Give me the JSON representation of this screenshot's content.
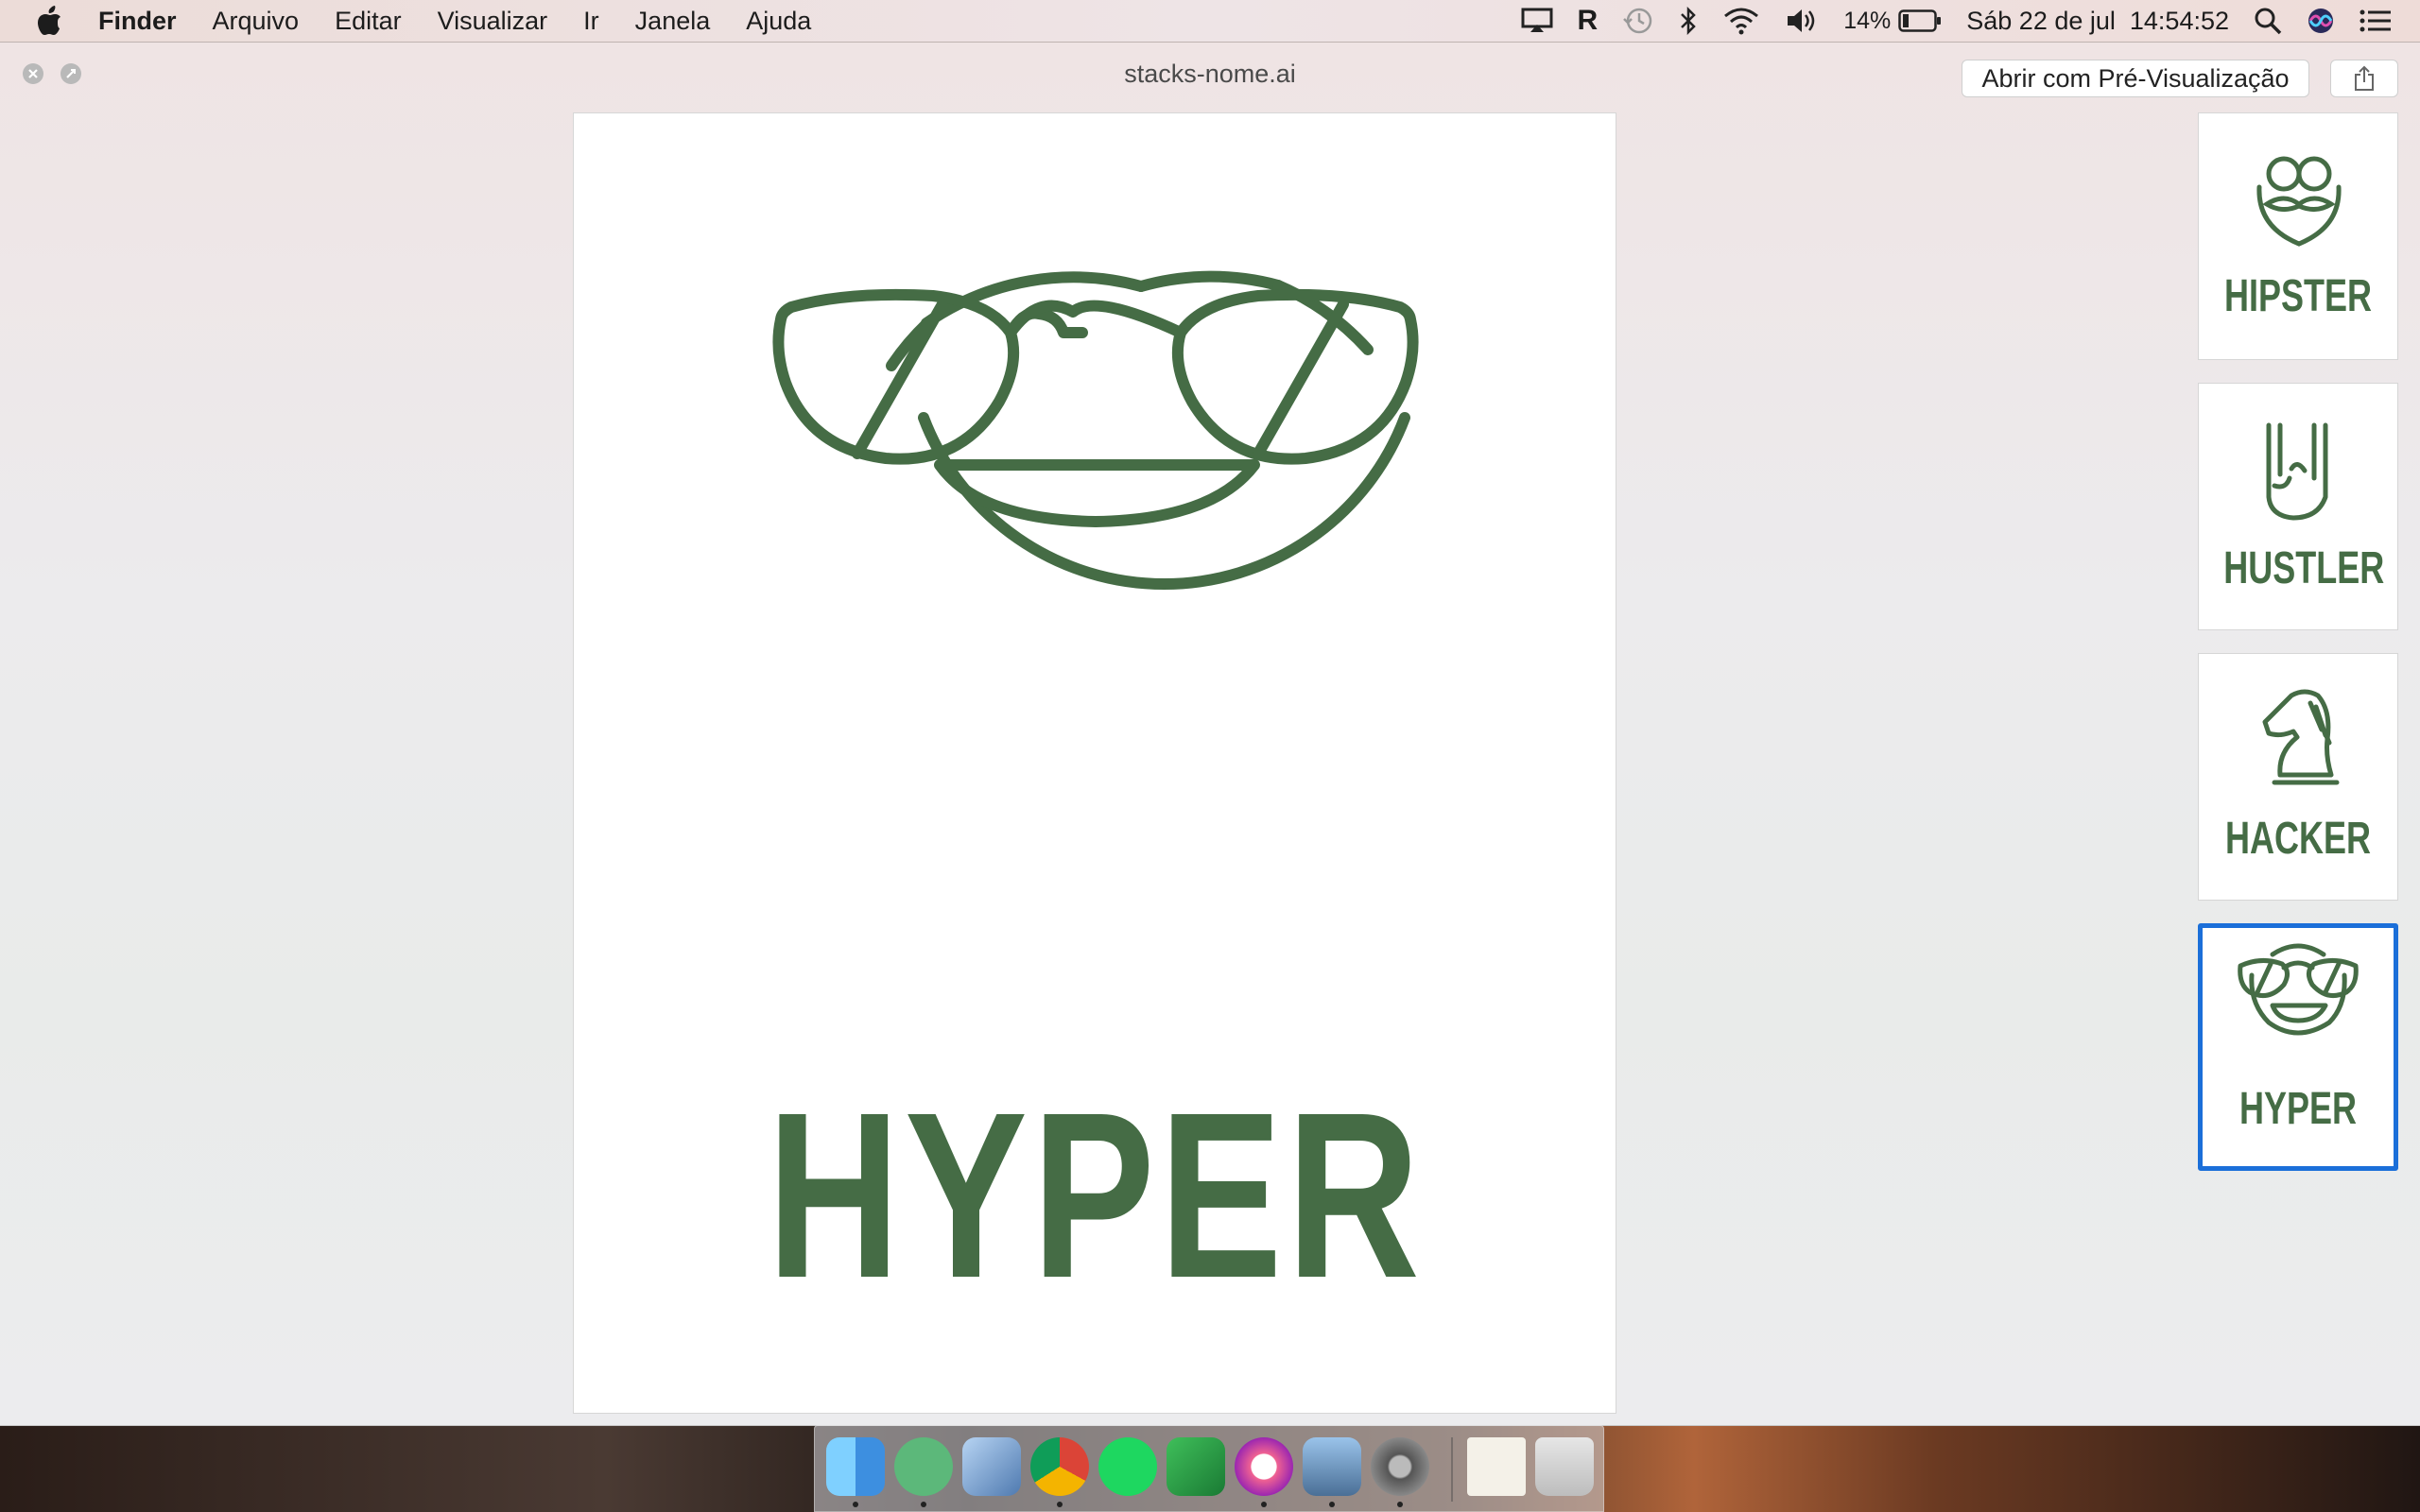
{
  "menubar": {
    "app_name": "Finder",
    "menus": [
      "Arquivo",
      "Editar",
      "Visualizar",
      "Ir",
      "Janela",
      "Ajuda"
    ],
    "battery": "14%",
    "datetime": "Sáb 22 de jul  14:54:52",
    "icons": [
      "apple-icon",
      "airplay-icon",
      "r-icon",
      "time-machine-icon",
      "bluetooth-icon",
      "wifi-icon",
      "volume-icon",
      "battery-icon",
      "search-icon",
      "siri-icon",
      "notification-center-icon"
    ]
  },
  "window": {
    "title": "stacks-nome.ai",
    "open_with_label": "Abrir com Pré-Visualização"
  },
  "document": {
    "title": "HYPER"
  },
  "thumbnails": [
    {
      "label": "HIPSTER",
      "icon": "hipster-face-icon",
      "selected": false
    },
    {
      "label": "HUSTLER",
      "icon": "rock-hand-icon",
      "selected": false
    },
    {
      "label": "HACKER",
      "icon": "chess-knight-icon",
      "selected": false
    },
    {
      "label": "HYPER",
      "icon": "sunglasses-smile-icon",
      "selected": true
    }
  ],
  "colors": {
    "logo_green": "#456c45",
    "selection_blue": "#1b6fd9"
  },
  "dock": {
    "apps": [
      "finder",
      "atom",
      "preview-eagle",
      "chrome",
      "spotify",
      "excel",
      "itunes",
      "image-capture",
      "system-preferences",
      "hogwarts-document",
      "trash"
    ]
  }
}
